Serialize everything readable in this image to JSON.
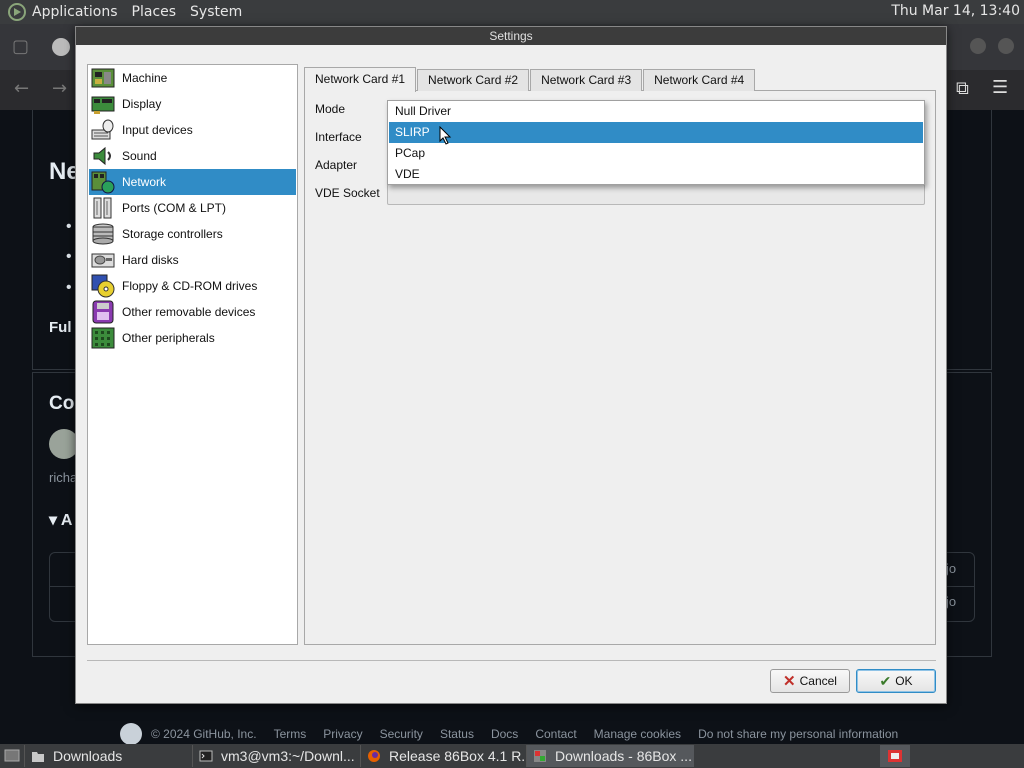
{
  "top_panel": {
    "menus": [
      "Applications",
      "Places",
      "System"
    ],
    "clock": "Thu Mar 14, 13:40"
  },
  "background_page": {
    "heading_fragments": [
      "Ne",
      "Ful",
      "Co",
      "A"
    ],
    "user_fragment": "richa",
    "row_suffix": [
      "jo",
      "jo"
    ],
    "footer": [
      "© 2024 GitHub, Inc.",
      "Terms",
      "Privacy",
      "Security",
      "Status",
      "Docs",
      "Contact",
      "Manage cookies",
      "Do not share my personal information"
    ]
  },
  "dialog": {
    "title": "Settings",
    "sidebar": [
      {
        "label": "Machine",
        "icon": "machine-icon"
      },
      {
        "label": "Display",
        "icon": "display-icon"
      },
      {
        "label": "Input devices",
        "icon": "input-devices-icon"
      },
      {
        "label": "Sound",
        "icon": "sound-icon"
      },
      {
        "label": "Network",
        "icon": "network-icon",
        "selected": true
      },
      {
        "label": "Ports (COM & LPT)",
        "icon": "ports-icon"
      },
      {
        "label": "Storage controllers",
        "icon": "storage-controllers-icon"
      },
      {
        "label": "Hard disks",
        "icon": "hard-disk-icon"
      },
      {
        "label": "Floppy & CD-ROM drives",
        "icon": "floppy-cdrom-icon"
      },
      {
        "label": "Other removable devices",
        "icon": "removable-devices-icon"
      },
      {
        "label": "Other peripherals",
        "icon": "peripherals-icon"
      }
    ],
    "tabs": [
      "Network Card #1",
      "Network Card #2",
      "Network Card #3",
      "Network Card #4"
    ],
    "active_tab": "Network Card #1",
    "form": {
      "mode_label": "Mode",
      "interface_label": "Interface",
      "adapter_label": "Adapter",
      "vde_socket_label": "VDE Socket",
      "vde_socket_value": ""
    },
    "mode_dropdown": {
      "options": [
        "Null Driver",
        "SLIRP",
        "PCap",
        "VDE"
      ],
      "highlighted": "SLIRP"
    },
    "buttons": {
      "cancel": "Cancel",
      "ok": "OK"
    }
  },
  "taskbar": {
    "items": [
      {
        "label": "Downloads",
        "icon": "folder-icon"
      },
      {
        "label": "vm3@vm3:~/Downl...",
        "icon": "terminal-icon"
      },
      {
        "label": "Release 86Box 4.1 R...",
        "icon": "firefox-icon"
      },
      {
        "label": "Downloads - 86Box ...",
        "icon": "86box-icon",
        "active": true
      }
    ]
  }
}
